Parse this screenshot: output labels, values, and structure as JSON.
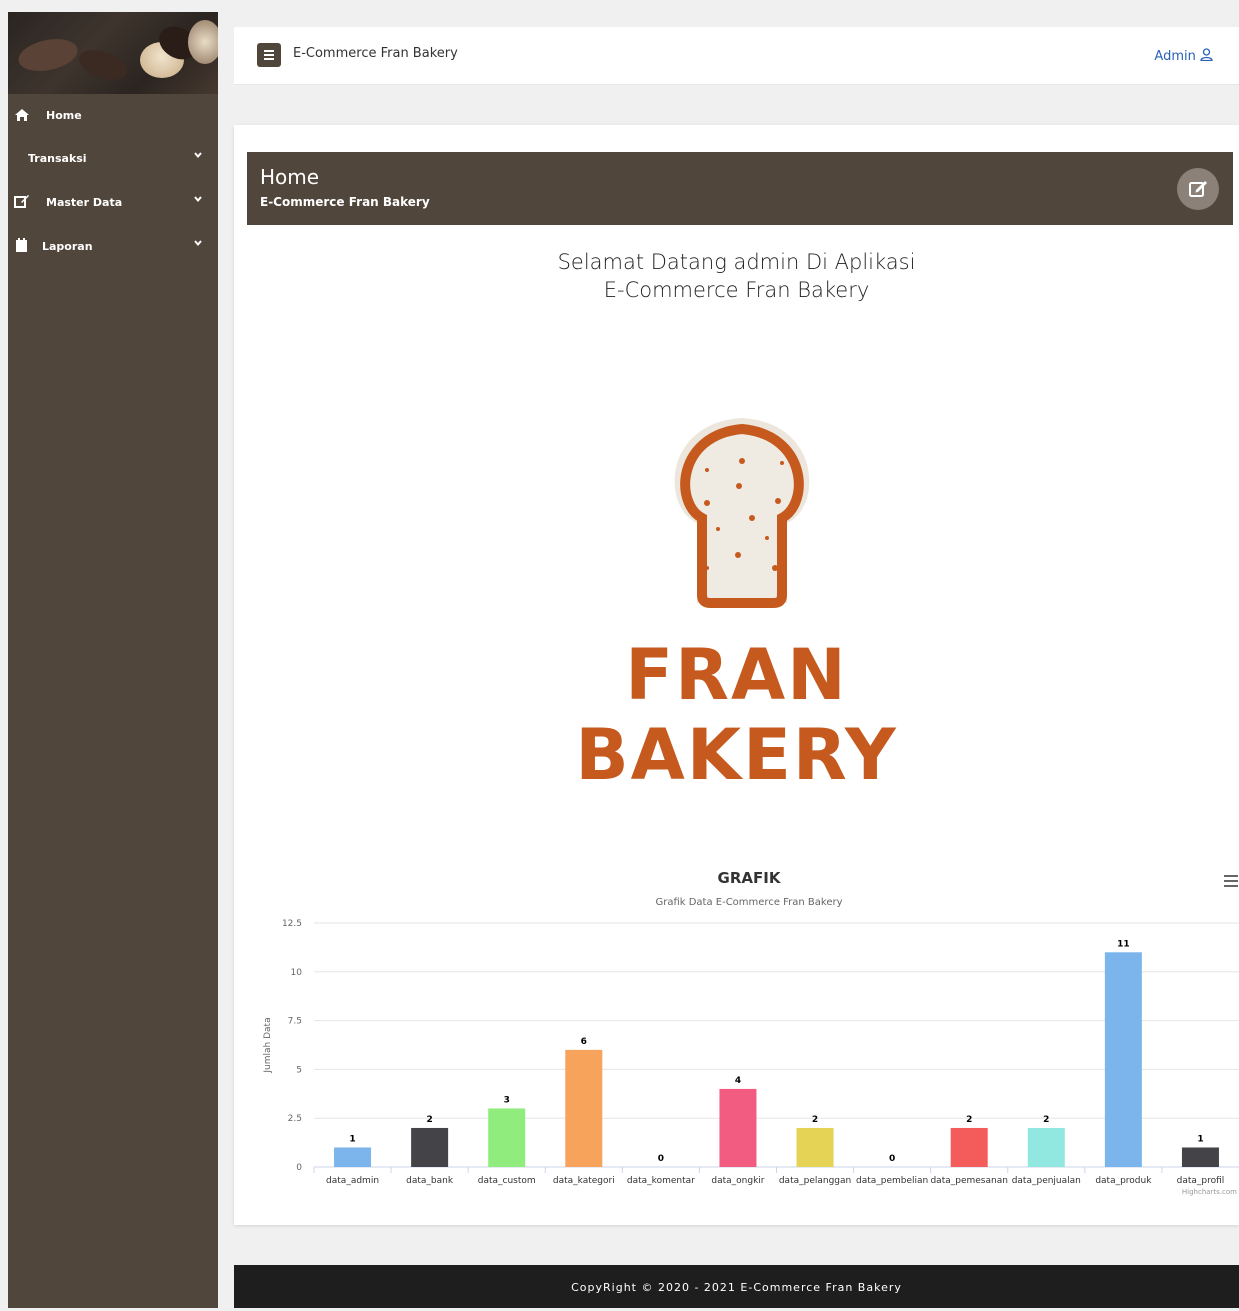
{
  "app": {
    "title": "E-Commerce Fran Bakery",
    "user": "Admin"
  },
  "sidebar": {
    "items": [
      {
        "label": "Home",
        "icon": "home-icon"
      },
      {
        "label": "Transaksi",
        "icon": ""
      },
      {
        "label": "Master Data",
        "icon": "edit-icon"
      },
      {
        "label": "Laporan",
        "icon": "calendar-icon"
      }
    ]
  },
  "page_header": {
    "title": "Home",
    "subtitle": "E-Commerce Fran Bakery"
  },
  "welcome": {
    "line1": "Selamat Datang admin Di Aplikasi",
    "line2": "E-Commerce Fran Bakery"
  },
  "logo": {
    "line1": "FRAN",
    "line2": "BAKERY",
    "brand_color": "#c65a1e"
  },
  "chart_data": {
    "type": "bar",
    "title": "GRAFIK",
    "subtitle": "Grafik Data E-Commerce Fran Bakery",
    "ylabel": "Jumlah Data",
    "xlabel": "",
    "ylim": [
      0,
      12.5
    ],
    "yticks": [
      "0",
      "2.5",
      "5",
      "7.5",
      "10",
      "12.5"
    ],
    "categories": [
      "data_admin",
      "data_bank",
      "data_custom",
      "data_kategori",
      "data_komentar",
      "data_ongkir",
      "data_pelanggan",
      "data_pembelian",
      "data_pemesanan",
      "data_penjualan",
      "data_produk",
      "data_profil"
    ],
    "values": [
      1,
      2,
      3,
      6,
      0,
      4,
      2,
      0,
      2,
      2,
      11,
      1
    ],
    "colors": [
      "#7cb5ec",
      "#434348",
      "#90ed7d",
      "#f7a35c",
      "#8085e9",
      "#f15c80",
      "#e4d354",
      "#2b908f",
      "#f45b5b",
      "#91e8e1",
      "#7cb5ec",
      "#434348"
    ],
    "grid": true,
    "credits": "Highcharts.com"
  },
  "footer": {
    "text": "CopyRight © 2020 - 2021 E-Commerce Fran Bakery"
  }
}
